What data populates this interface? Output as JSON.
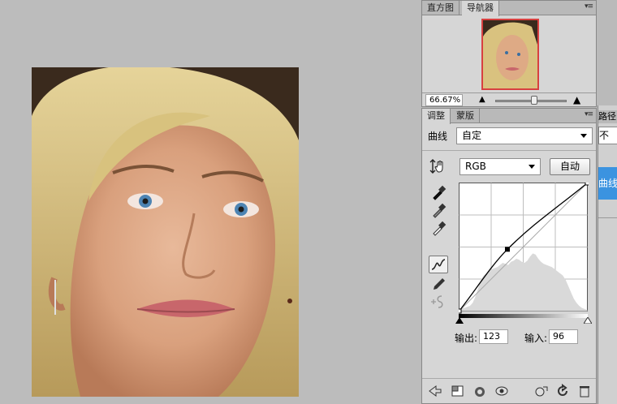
{
  "navigator": {
    "tabs": [
      "直方图",
      "导航器"
    ],
    "active_tab": "导航器",
    "zoom": "66.67%",
    "zoom_slider": 0.55
  },
  "adjustments": {
    "tabs": [
      "调整",
      "蒙版"
    ],
    "active_tab": "调整",
    "type_label": "曲线",
    "preset_value": "自定",
    "channel_value": "RGB",
    "auto_button": "自动",
    "output_label": "输出:",
    "output_value": "123",
    "input_label": "输入:",
    "input_value": "96"
  },
  "side_panel": {
    "tab": "路径",
    "dropdown_text": "不",
    "selected_layer": "曲线"
  },
  "curve": {
    "control_points": [
      [
        0,
        0
      ],
      [
        96,
        123
      ],
      [
        255,
        255
      ]
    ],
    "histogram": [
      2,
      3,
      3,
      4,
      5,
      8,
      14,
      22,
      30,
      34,
      36,
      38,
      40,
      41,
      42,
      44,
      46,
      45,
      44,
      47,
      48,
      50,
      49,
      47,
      46,
      48,
      52,
      55,
      54,
      50,
      47,
      45,
      44,
      43,
      42,
      40,
      38,
      36,
      34,
      30,
      24,
      18,
      12,
      8,
      5,
      3,
      2,
      1
    ]
  },
  "colors": {
    "accent_blue": "#3b93e0",
    "navigator_frame": "#d84040"
  }
}
